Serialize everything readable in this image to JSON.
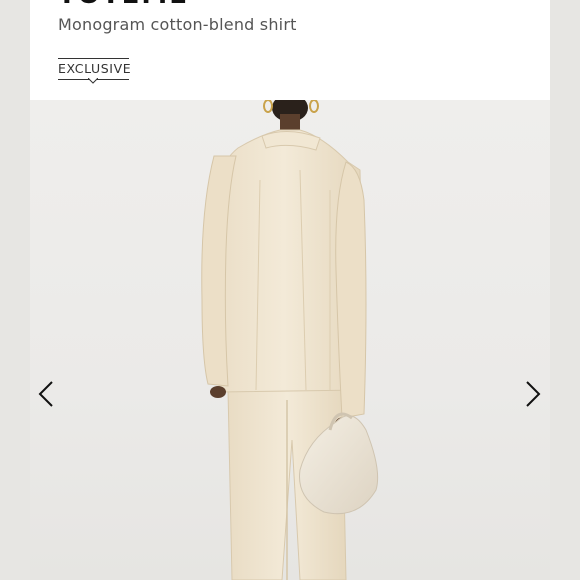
{
  "product": {
    "brand": "TOTEME",
    "name": "Monogram cotton-blend shirt",
    "badge": "EXCLUSIVE"
  },
  "gallery": {
    "image_icon": "model-back-view-image",
    "prev_icon": "chevron-left-icon",
    "next_icon": "chevron-right-icon"
  },
  "colors": {
    "background": "#e9e8e6",
    "header_bg": "#ffffff",
    "text_primary": "#111111",
    "text_secondary": "#555555",
    "garment": "#efe4cf"
  }
}
